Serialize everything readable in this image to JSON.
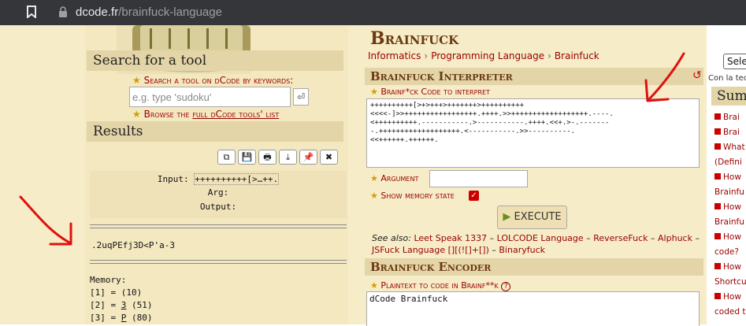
{
  "browser": {
    "url_domain": "dcode.fr",
    "url_path": "/brainfuck-language"
  },
  "sidebar": {
    "search_title": "Search for a tool",
    "search_by_keywords": "Search a tool on dCode by keywords:",
    "search_placeholder": "e.g. type 'sudoku'",
    "search_button": "⏎",
    "browse_prefix": "Browse the ",
    "browse_link": "full dCode tools' list",
    "results_title": "Results",
    "result_buttons": [
      "⧉",
      "💾",
      "🖶",
      "⤓",
      "📌",
      "✖"
    ],
    "input_label": "Input:",
    "input_value": "++++++++++[>…++.",
    "arg_label": "Arg:",
    "output_label": "Output:",
    "output_text": ".2uqPEfj3D<P'a-3",
    "memory_title": "Memory:",
    "memory_rows": [
      {
        "index": "[1] =",
        "char": " ",
        "value": "(10)"
      },
      {
        "index": "[2] =",
        "char": "3",
        "value": "(51)"
      },
      {
        "index": "[3] =",
        "char": "P",
        "value": "(80)"
      }
    ]
  },
  "main": {
    "title": "Brainfuck",
    "breadcrumbs": [
      "Informatics",
      "Programming Language",
      "Brainfuck"
    ],
    "interpreter_title": "Brainfuck Interpreter",
    "code_label": "Brainf*ck Code to interpret",
    "code_lines": [
      "++++++++++[>+>+++>+++++++>++++++++++",
      "<<<<-]>>+++++++++++++++++.++++.>>++++++++++++++++++.----.",
      "<++++++++++.-----------.>-----------.++++.<<+.>-.-------",
      "-.+++++++++++++++++++.<-----------.>>----------.",
      "<<++++++.++++++."
    ],
    "argument_label": "Argument",
    "memory_state_label": "Show memory state",
    "execute_label": "EXECUTE",
    "see_also_label": "See also:",
    "see_also_links": [
      "Leet Speak 1337",
      "LOLCODE Language",
      "ReverseFuck",
      "Alphuck",
      "JSFuck Language [][(![]+[])",
      "Binaryfuck"
    ],
    "encoder_title": "Brainfuck Encoder",
    "plaintext_label": "Plaintext to code in Brainf**k",
    "plaintext_value": "dCode Brainfuck"
  },
  "right": {
    "select_value": "Sele",
    "con_la": "Con la tec",
    "summary_title": "Summ",
    "summary_items": [
      "Brai",
      "Brai",
      "What",
      "(Defini",
      "How",
      "Brainfu",
      "How",
      "Brainfu",
      "How",
      "code?",
      "How",
      "Shortcu",
      "How",
      "coded t"
    ]
  },
  "colors": {
    "accent_title": "#6b3a12",
    "link": "#990000",
    "panel": "#e3d5a7",
    "annotation_arrow": "#e01010"
  }
}
